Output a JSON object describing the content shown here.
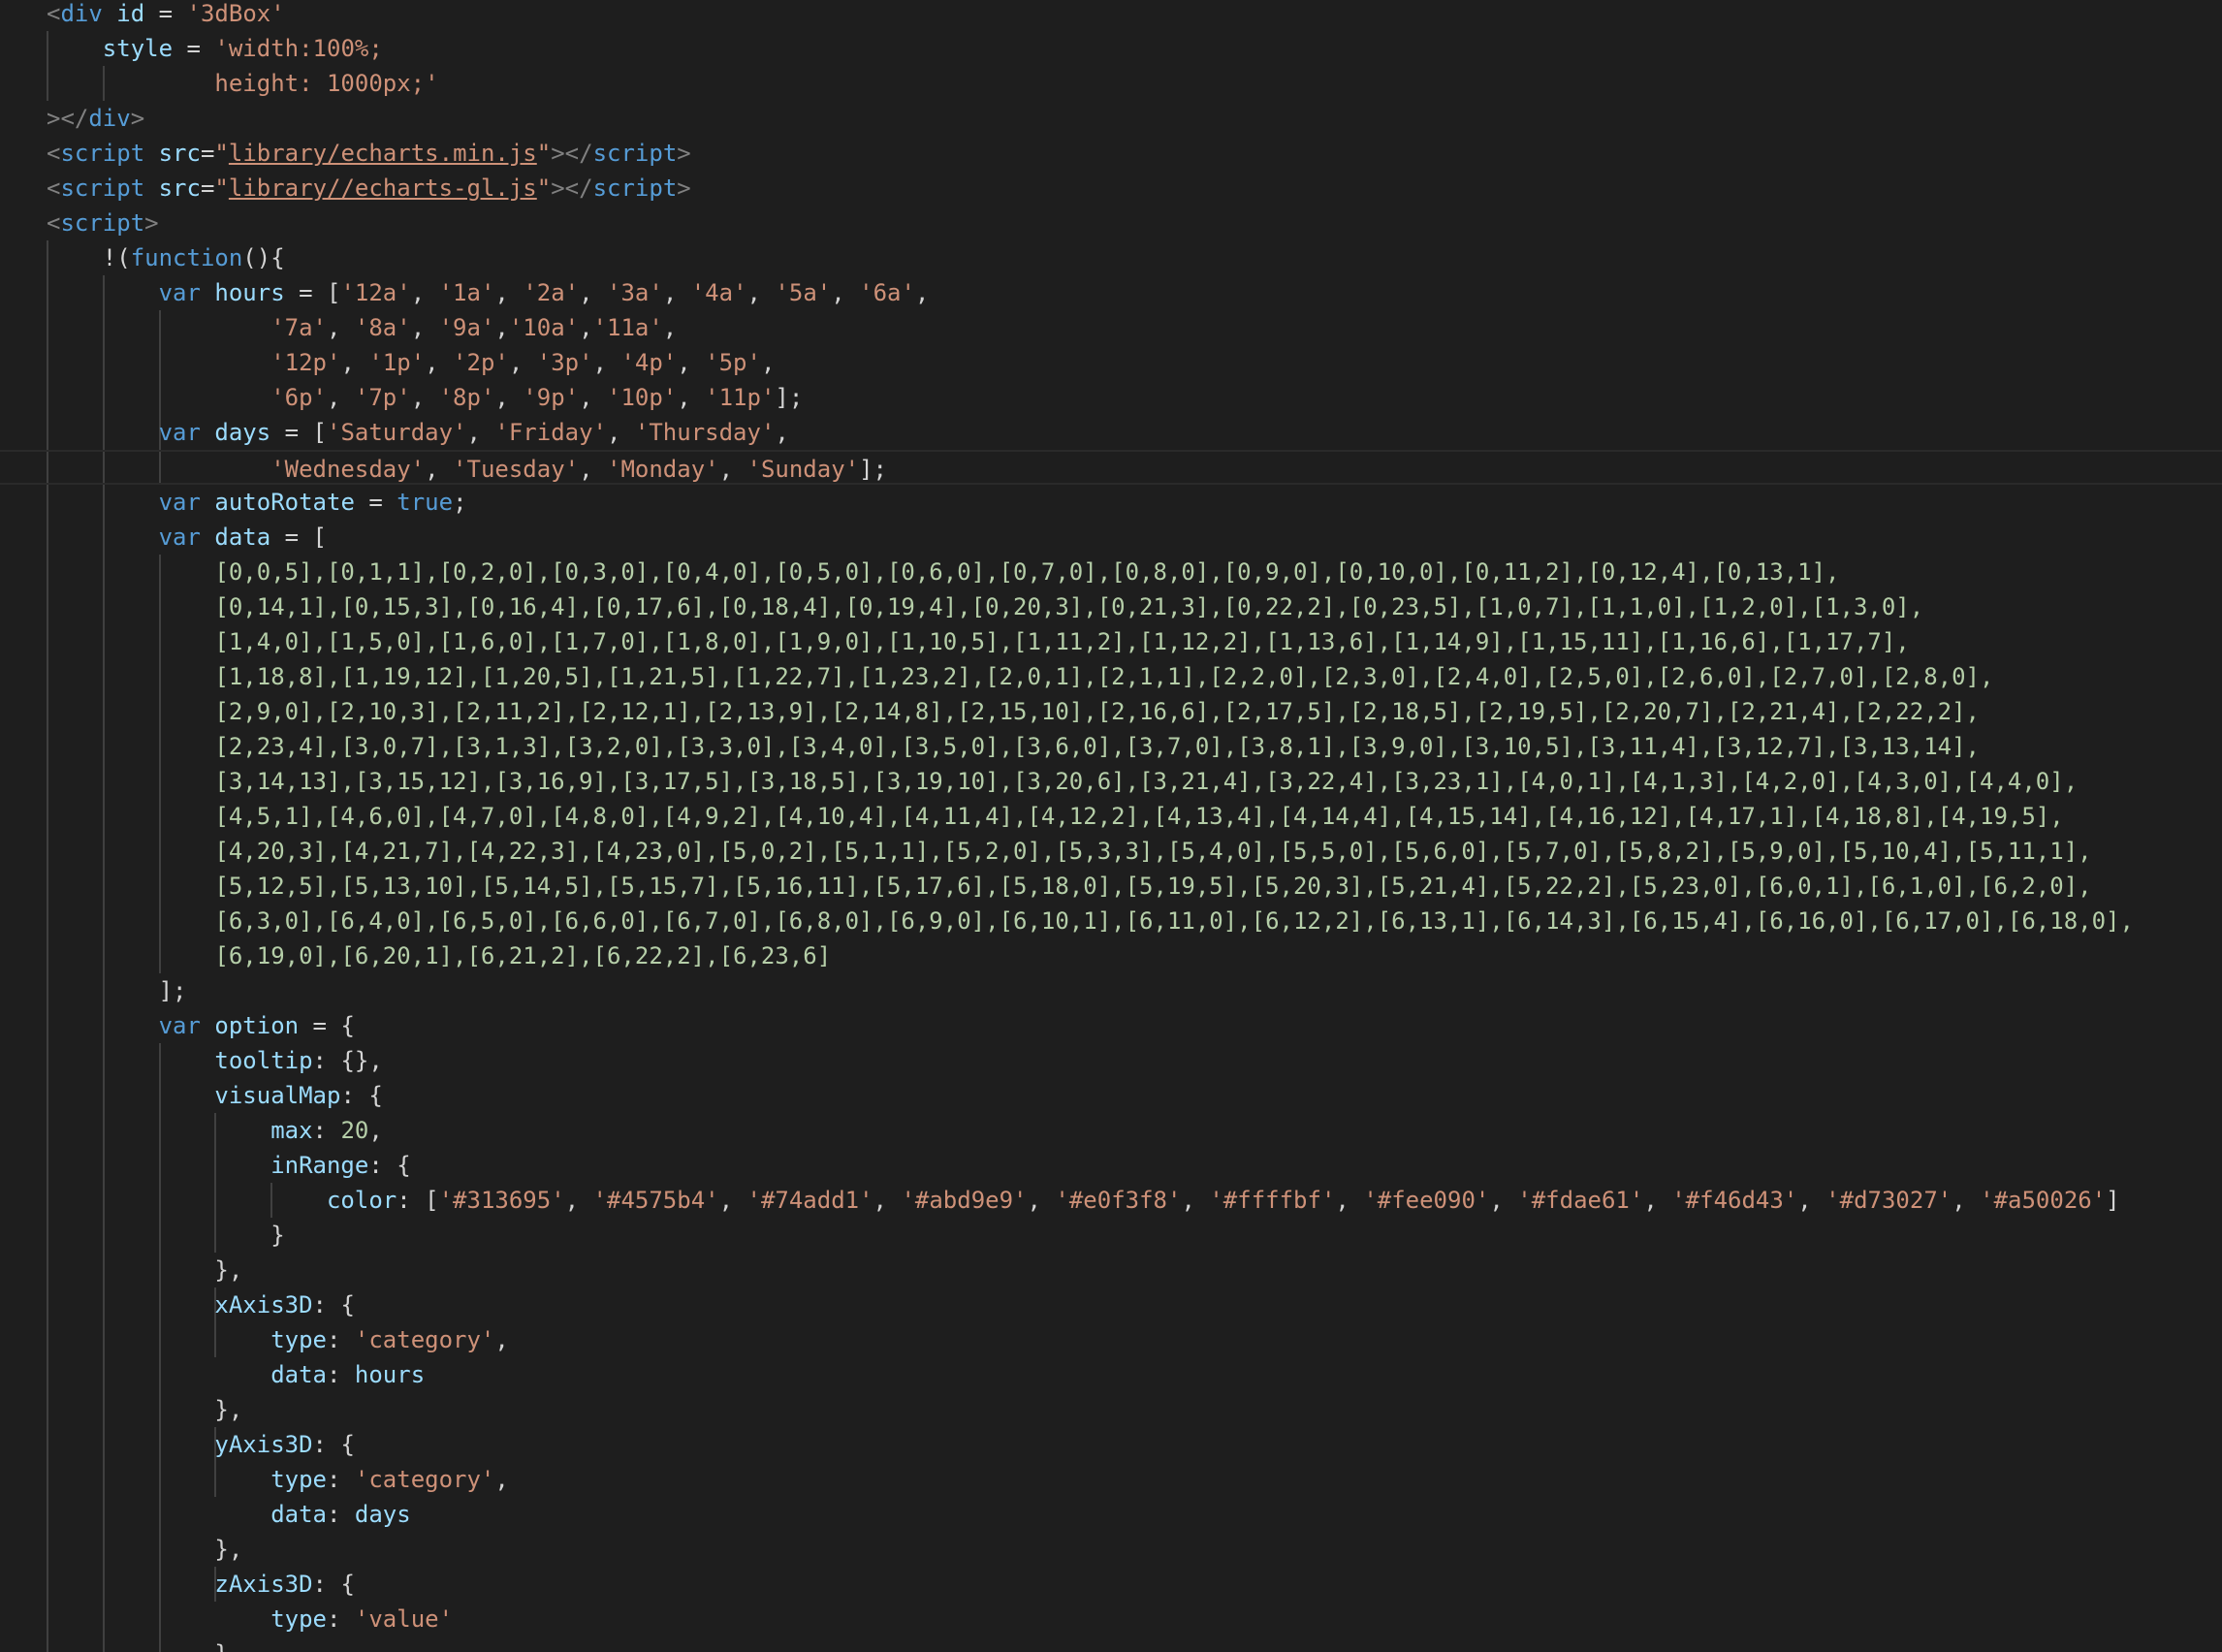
{
  "editor": {
    "lines": [
      [
        {
          "t": "<",
          "c": "punct"
        },
        {
          "t": "div",
          "c": "tag"
        },
        {
          "t": " ",
          "c": "plain"
        },
        {
          "t": "id",
          "c": "attr"
        },
        {
          "t": " = ",
          "c": "plain"
        },
        {
          "t": "'3dBox'",
          "c": "str"
        }
      ],
      [
        {
          "t": "    ",
          "c": "plain"
        },
        {
          "t": "style",
          "c": "attr"
        },
        {
          "t": " = ",
          "c": "plain"
        },
        {
          "t": "'width:100%;",
          "c": "str"
        }
      ],
      [
        {
          "t": "            ",
          "c": "plain"
        },
        {
          "t": "height: 1000px;'",
          "c": "str"
        }
      ],
      [
        {
          "t": "></",
          "c": "punct"
        },
        {
          "t": "div",
          "c": "tag"
        },
        {
          "t": ">",
          "c": "punct"
        }
      ],
      [
        {
          "t": "<",
          "c": "punct"
        },
        {
          "t": "script",
          "c": "tag"
        },
        {
          "t": " ",
          "c": "plain"
        },
        {
          "t": "src",
          "c": "attr"
        },
        {
          "t": "=",
          "c": "plain"
        },
        {
          "t": "\"",
          "c": "str"
        },
        {
          "t": "library/echarts.min.js",
          "c": "link"
        },
        {
          "t": "\"",
          "c": "str"
        },
        {
          "t": "></",
          "c": "punct"
        },
        {
          "t": "script",
          "c": "tag"
        },
        {
          "t": ">",
          "c": "punct"
        }
      ],
      [
        {
          "t": "<",
          "c": "punct"
        },
        {
          "t": "script",
          "c": "tag"
        },
        {
          "t": " ",
          "c": "plain"
        },
        {
          "t": "src",
          "c": "attr"
        },
        {
          "t": "=",
          "c": "plain"
        },
        {
          "t": "\"",
          "c": "str"
        },
        {
          "t": "library//echarts-gl.js",
          "c": "link"
        },
        {
          "t": "\"",
          "c": "str"
        },
        {
          "t": "></",
          "c": "punct"
        },
        {
          "t": "script",
          "c": "tag"
        },
        {
          "t": ">",
          "c": "punct"
        }
      ],
      [
        {
          "t": "<",
          "c": "punct"
        },
        {
          "t": "script",
          "c": "tag"
        },
        {
          "t": ">",
          "c": "punct"
        }
      ],
      [
        {
          "t": "    ",
          "c": "plain"
        },
        {
          "t": "!(",
          "c": "plain"
        },
        {
          "t": "function",
          "c": "kw"
        },
        {
          "t": "(){",
          "c": "plain"
        }
      ],
      [
        {
          "t": "        ",
          "c": "plain"
        },
        {
          "t": "var",
          "c": "kw"
        },
        {
          "t": " ",
          "c": "plain"
        },
        {
          "t": "hours",
          "c": "var"
        },
        {
          "t": " = [",
          "c": "plain"
        },
        {
          "t": "'12a'",
          "c": "str"
        },
        {
          "t": ", ",
          "c": "plain"
        },
        {
          "t": "'1a'",
          "c": "str"
        },
        {
          "t": ", ",
          "c": "plain"
        },
        {
          "t": "'2a'",
          "c": "str"
        },
        {
          "t": ", ",
          "c": "plain"
        },
        {
          "t": "'3a'",
          "c": "str"
        },
        {
          "t": ", ",
          "c": "plain"
        },
        {
          "t": "'4a'",
          "c": "str"
        },
        {
          "t": ", ",
          "c": "plain"
        },
        {
          "t": "'5a'",
          "c": "str"
        },
        {
          "t": ", ",
          "c": "plain"
        },
        {
          "t": "'6a'",
          "c": "str"
        },
        {
          "t": ",",
          "c": "plain"
        }
      ],
      [
        {
          "t": "                ",
          "c": "plain"
        },
        {
          "t": "'7a'",
          "c": "str"
        },
        {
          "t": ", ",
          "c": "plain"
        },
        {
          "t": "'8a'",
          "c": "str"
        },
        {
          "t": ", ",
          "c": "plain"
        },
        {
          "t": "'9a'",
          "c": "str"
        },
        {
          "t": ",",
          "c": "plain"
        },
        {
          "t": "'10a'",
          "c": "str"
        },
        {
          "t": ",",
          "c": "plain"
        },
        {
          "t": "'11a'",
          "c": "str"
        },
        {
          "t": ",",
          "c": "plain"
        }
      ],
      [
        {
          "t": "                ",
          "c": "plain"
        },
        {
          "t": "'12p'",
          "c": "str"
        },
        {
          "t": ", ",
          "c": "plain"
        },
        {
          "t": "'1p'",
          "c": "str"
        },
        {
          "t": ", ",
          "c": "plain"
        },
        {
          "t": "'2p'",
          "c": "str"
        },
        {
          "t": ", ",
          "c": "plain"
        },
        {
          "t": "'3p'",
          "c": "str"
        },
        {
          "t": ", ",
          "c": "plain"
        },
        {
          "t": "'4p'",
          "c": "str"
        },
        {
          "t": ", ",
          "c": "plain"
        },
        {
          "t": "'5p'",
          "c": "str"
        },
        {
          "t": ",",
          "c": "plain"
        }
      ],
      [
        {
          "t": "                ",
          "c": "plain"
        },
        {
          "t": "'6p'",
          "c": "str"
        },
        {
          "t": ", ",
          "c": "plain"
        },
        {
          "t": "'7p'",
          "c": "str"
        },
        {
          "t": ", ",
          "c": "plain"
        },
        {
          "t": "'8p'",
          "c": "str"
        },
        {
          "t": ", ",
          "c": "plain"
        },
        {
          "t": "'9p'",
          "c": "str"
        },
        {
          "t": ", ",
          "c": "plain"
        },
        {
          "t": "'10p'",
          "c": "str"
        },
        {
          "t": ", ",
          "c": "plain"
        },
        {
          "t": "'11p'",
          "c": "str"
        },
        {
          "t": "];",
          "c": "plain"
        }
      ],
      [
        {
          "t": "        ",
          "c": "plain"
        },
        {
          "t": "var",
          "c": "kw"
        },
        {
          "t": " ",
          "c": "plain"
        },
        {
          "t": "days",
          "c": "var"
        },
        {
          "t": " = [",
          "c": "plain"
        },
        {
          "t": "'Saturday'",
          "c": "str"
        },
        {
          "t": ", ",
          "c": "plain"
        },
        {
          "t": "'Friday'",
          "c": "str"
        },
        {
          "t": ", ",
          "c": "plain"
        },
        {
          "t": "'Thursday'",
          "c": "str"
        },
        {
          "t": ",",
          "c": "plain"
        }
      ],
      [
        {
          "t": "                ",
          "c": "plain"
        },
        {
          "t": "'Wednesday'",
          "c": "str"
        },
        {
          "t": ", ",
          "c": "plain"
        },
        {
          "t": "'Tuesday'",
          "c": "str"
        },
        {
          "t": ", ",
          "c": "plain"
        },
        {
          "t": "'Monday'",
          "c": "str"
        },
        {
          "t": ", ",
          "c": "plain"
        },
        {
          "t": "'Sunday'",
          "c": "str"
        },
        {
          "t": "];",
          "c": "plain"
        }
      ],
      [
        {
          "t": "        ",
          "c": "plain"
        },
        {
          "t": "var",
          "c": "kw"
        },
        {
          "t": " ",
          "c": "plain"
        },
        {
          "t": "autoRotate",
          "c": "var"
        },
        {
          "t": " = ",
          "c": "plain"
        },
        {
          "t": "true",
          "c": "kw"
        },
        {
          "t": ";",
          "c": "plain"
        }
      ],
      [
        {
          "t": "        ",
          "c": "plain"
        },
        {
          "t": "var",
          "c": "kw"
        },
        {
          "t": " ",
          "c": "plain"
        },
        {
          "t": "data",
          "c": "var"
        },
        {
          "t": " = [",
          "c": "plain"
        }
      ],
      [
        {
          "t": "            ",
          "c": "plain"
        },
        {
          "t": "[0,0,5],[0,1,1],[0,2,0],[0,3,0],[0,4,0],[0,5,0],[0,6,0],[0,7,0],[0,8,0],[0,9,0],[0,10,0],[0,11,2],[0,12,4],[0,13,1],",
          "c": "num"
        }
      ],
      [
        {
          "t": "            ",
          "c": "plain"
        },
        {
          "t": "[0,14,1],[0,15,3],[0,16,4],[0,17,6],[0,18,4],[0,19,4],[0,20,3],[0,21,3],[0,22,2],[0,23,5],[1,0,7],[1,1,0],[1,2,0],[1,3,0],",
          "c": "num"
        }
      ],
      [
        {
          "t": "            ",
          "c": "plain"
        },
        {
          "t": "[1,4,0],[1,5,0],[1,6,0],[1,7,0],[1,8,0],[1,9,0],[1,10,5],[1,11,2],[1,12,2],[1,13,6],[1,14,9],[1,15,11],[1,16,6],[1,17,7],",
          "c": "num"
        }
      ],
      [
        {
          "t": "            ",
          "c": "plain"
        },
        {
          "t": "[1,18,8],[1,19,12],[1,20,5],[1,21,5],[1,22,7],[1,23,2],[2,0,1],[2,1,1],[2,2,0],[2,3,0],[2,4,0],[2,5,0],[2,6,0],[2,7,0],[2,8,0],",
          "c": "num"
        }
      ],
      [
        {
          "t": "            ",
          "c": "plain"
        },
        {
          "t": "[2,9,0],[2,10,3],[2,11,2],[2,12,1],[2,13,9],[2,14,8],[2,15,10],[2,16,6],[2,17,5],[2,18,5],[2,19,5],[2,20,7],[2,21,4],[2,22,2],",
          "c": "num"
        }
      ],
      [
        {
          "t": "            ",
          "c": "plain"
        },
        {
          "t": "[2,23,4],[3,0,7],[3,1,3],[3,2,0],[3,3,0],[3,4,0],[3,5,0],[3,6,0],[3,7,0],[3,8,1],[3,9,0],[3,10,5],[3,11,4],[3,12,7],[3,13,14],",
          "c": "num"
        }
      ],
      [
        {
          "t": "            ",
          "c": "plain"
        },
        {
          "t": "[3,14,13],[3,15,12],[3,16,9],[3,17,5],[3,18,5],[3,19,10],[3,20,6],[3,21,4],[3,22,4],[3,23,1],[4,0,1],[4,1,3],[4,2,0],[4,3,0],[4,4,0],",
          "c": "num"
        }
      ],
      [
        {
          "t": "            ",
          "c": "plain"
        },
        {
          "t": "[4,5,1],[4,6,0],[4,7,0],[4,8,0],[4,9,2],[4,10,4],[4,11,4],[4,12,2],[4,13,4],[4,14,4],[4,15,14],[4,16,12],[4,17,1],[4,18,8],[4,19,5],",
          "c": "num"
        }
      ],
      [
        {
          "t": "            ",
          "c": "plain"
        },
        {
          "t": "[4,20,3],[4,21,7],[4,22,3],[4,23,0],[5,0,2],[5,1,1],[5,2,0],[5,3,3],[5,4,0],[5,5,0],[5,6,0],[5,7,0],[5,8,2],[5,9,0],[5,10,4],[5,11,1],",
          "c": "num"
        }
      ],
      [
        {
          "t": "            ",
          "c": "plain"
        },
        {
          "t": "[5,12,5],[5,13,10],[5,14,5],[5,15,7],[5,16,11],[5,17,6],[5,18,0],[5,19,5],[5,20,3],[5,21,4],[5,22,2],[5,23,0],[6,0,1],[6,1,0],[6,2,0],",
          "c": "num"
        }
      ],
      [
        {
          "t": "            ",
          "c": "plain"
        },
        {
          "t": "[6,3,0],[6,4,0],[6,5,0],[6,6,0],[6,7,0],[6,8,0],[6,9,0],[6,10,1],[6,11,0],[6,12,2],[6,13,1],[6,14,3],[6,15,4],[6,16,0],[6,17,0],[6,18,0],",
          "c": "num"
        }
      ],
      [
        {
          "t": "            ",
          "c": "plain"
        },
        {
          "t": "[6,19,0],[6,20,1],[6,21,2],[6,22,2],[6,23,6]",
          "c": "num"
        }
      ],
      [
        {
          "t": "        ",
          "c": "plain"
        },
        {
          "t": "];",
          "c": "plain"
        }
      ],
      [
        {
          "t": "        ",
          "c": "plain"
        },
        {
          "t": "var",
          "c": "kw"
        },
        {
          "t": " ",
          "c": "plain"
        },
        {
          "t": "option",
          "c": "var"
        },
        {
          "t": " = {",
          "c": "plain"
        }
      ],
      [
        {
          "t": "            ",
          "c": "plain"
        },
        {
          "t": "tooltip",
          "c": "prop"
        },
        {
          "t": ": {},",
          "c": "plain"
        }
      ],
      [
        {
          "t": "            ",
          "c": "plain"
        },
        {
          "t": "visualMap",
          "c": "prop"
        },
        {
          "t": ": {",
          "c": "plain"
        }
      ],
      [
        {
          "t": "                ",
          "c": "plain"
        },
        {
          "t": "max",
          "c": "prop"
        },
        {
          "t": ": ",
          "c": "plain"
        },
        {
          "t": "20",
          "c": "num"
        },
        {
          "t": ",",
          "c": "plain"
        }
      ],
      [
        {
          "t": "                ",
          "c": "plain"
        },
        {
          "t": "inRange",
          "c": "prop"
        },
        {
          "t": ": {",
          "c": "plain"
        }
      ],
      [
        {
          "t": "                    ",
          "c": "plain"
        },
        {
          "t": "color",
          "c": "prop"
        },
        {
          "t": ": [",
          "c": "plain"
        },
        {
          "t": "'#313695'",
          "c": "str"
        },
        {
          "t": ", ",
          "c": "plain"
        },
        {
          "t": "'#4575b4'",
          "c": "str"
        },
        {
          "t": ", ",
          "c": "plain"
        },
        {
          "t": "'#74add1'",
          "c": "str"
        },
        {
          "t": ", ",
          "c": "plain"
        },
        {
          "t": "'#abd9e9'",
          "c": "str"
        },
        {
          "t": ", ",
          "c": "plain"
        },
        {
          "t": "'#e0f3f8'",
          "c": "str"
        },
        {
          "t": ", ",
          "c": "plain"
        },
        {
          "t": "'#ffffbf'",
          "c": "str"
        },
        {
          "t": ", ",
          "c": "plain"
        },
        {
          "t": "'#fee090'",
          "c": "str"
        },
        {
          "t": ", ",
          "c": "plain"
        },
        {
          "t": "'#fdae61'",
          "c": "str"
        },
        {
          "t": ", ",
          "c": "plain"
        },
        {
          "t": "'#f46d43'",
          "c": "str"
        },
        {
          "t": ", ",
          "c": "plain"
        },
        {
          "t": "'#d73027'",
          "c": "str"
        },
        {
          "t": ", ",
          "c": "plain"
        },
        {
          "t": "'#a50026'",
          "c": "str"
        },
        {
          "t": "]",
          "c": "plain"
        }
      ],
      [
        {
          "t": "                ",
          "c": "plain"
        },
        {
          "t": "}",
          "c": "plain"
        }
      ],
      [
        {
          "t": "            ",
          "c": "plain"
        },
        {
          "t": "},",
          "c": "plain"
        }
      ],
      [
        {
          "t": "            ",
          "c": "plain"
        },
        {
          "t": "xAxis3D",
          "c": "prop"
        },
        {
          "t": ": {",
          "c": "plain"
        }
      ],
      [
        {
          "t": "                ",
          "c": "plain"
        },
        {
          "t": "type",
          "c": "prop"
        },
        {
          "t": ": ",
          "c": "plain"
        },
        {
          "t": "'category'",
          "c": "str"
        },
        {
          "t": ",",
          "c": "plain"
        }
      ],
      [
        {
          "t": "                ",
          "c": "plain"
        },
        {
          "t": "data",
          "c": "prop"
        },
        {
          "t": ": ",
          "c": "plain"
        },
        {
          "t": "hours",
          "c": "var"
        }
      ],
      [
        {
          "t": "            ",
          "c": "plain"
        },
        {
          "t": "},",
          "c": "plain"
        }
      ],
      [
        {
          "t": "            ",
          "c": "plain"
        },
        {
          "t": "yAxis3D",
          "c": "prop"
        },
        {
          "t": ": {",
          "c": "plain"
        }
      ],
      [
        {
          "t": "                ",
          "c": "plain"
        },
        {
          "t": "type",
          "c": "prop"
        },
        {
          "t": ": ",
          "c": "plain"
        },
        {
          "t": "'category'",
          "c": "str"
        },
        {
          "t": ",",
          "c": "plain"
        }
      ],
      [
        {
          "t": "                ",
          "c": "plain"
        },
        {
          "t": "data",
          "c": "prop"
        },
        {
          "t": ": ",
          "c": "plain"
        },
        {
          "t": "days",
          "c": "var"
        }
      ],
      [
        {
          "t": "            ",
          "c": "plain"
        },
        {
          "t": "},",
          "c": "plain"
        }
      ],
      [
        {
          "t": "            ",
          "c": "plain"
        },
        {
          "t": "zAxis3D",
          "c": "prop"
        },
        {
          "t": ": {",
          "c": "plain"
        }
      ],
      [
        {
          "t": "                ",
          "c": "plain"
        },
        {
          "t": "type",
          "c": "prop"
        },
        {
          "t": ": ",
          "c": "plain"
        },
        {
          "t": "'value'",
          "c": "str"
        }
      ],
      [
        {
          "t": "            ",
          "c": "plain"
        },
        {
          "t": "}",
          "c": "plain"
        }
      ]
    ]
  }
}
